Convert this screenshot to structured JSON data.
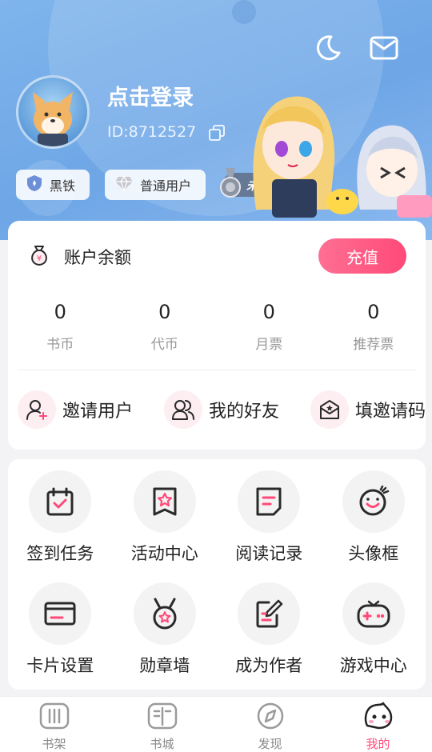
{
  "header": {
    "login_text": "点击登录",
    "user_id": "ID:8712527",
    "badges": [
      {
        "label": "黑铁",
        "icon": "shield-icon"
      },
      {
        "label": "普通用户",
        "icon": "diamond-icon"
      }
    ],
    "vip_label": "未开通"
  },
  "account": {
    "title": "账户余额",
    "recharge_label": "充值",
    "stats": [
      {
        "value": "0",
        "label": "书币"
      },
      {
        "value": "0",
        "label": "代币"
      },
      {
        "value": "0",
        "label": "月票"
      },
      {
        "value": "0",
        "label": "推荐票"
      }
    ],
    "social": [
      {
        "label": "邀请用户",
        "icon": "add-user-icon"
      },
      {
        "label": "我的好友",
        "icon": "friends-icon"
      },
      {
        "label": "填邀请码",
        "icon": "invite-code-icon"
      }
    ]
  },
  "features": [
    {
      "label": "签到任务",
      "icon": "calendar-check-icon"
    },
    {
      "label": "活动中心",
      "icon": "star-bookmark-icon"
    },
    {
      "label": "阅读记录",
      "icon": "reading-record-icon"
    },
    {
      "label": "头像框",
      "icon": "smiley-icon"
    },
    {
      "label": "卡片设置",
      "icon": "card-icon"
    },
    {
      "label": "勋章墙",
      "icon": "medal-icon"
    },
    {
      "label": "成为作者",
      "icon": "edit-icon"
    },
    {
      "label": "游戏中心",
      "icon": "gamepad-icon"
    }
  ],
  "tabs": [
    {
      "label": "书架",
      "icon": "bookshelf-icon"
    },
    {
      "label": "书城",
      "icon": "book-icon"
    },
    {
      "label": "发现",
      "icon": "compass-icon"
    },
    {
      "label": "我的",
      "icon": "mascot-icon",
      "active": true
    }
  ],
  "colors": {
    "accent": "#ff4a78",
    "header_bg": "#7fb5ec",
    "icon_dark": "#2a2a2a"
  }
}
